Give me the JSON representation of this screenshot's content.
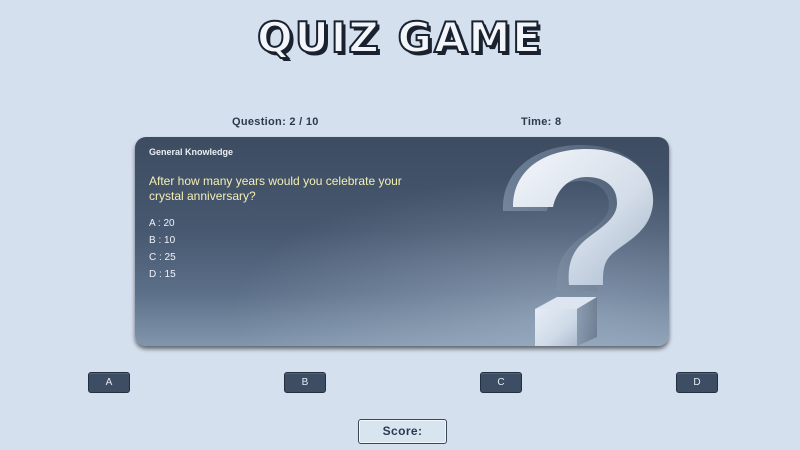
{
  "game": {
    "logo_text": "QUIZ GAME"
  },
  "hud": {
    "question_label": "Question: 2 / 10",
    "time_label": "Time: 8"
  },
  "card": {
    "category": "General Knowledge",
    "question": "After how many years would you celebrate your crystal anniversary?",
    "options": [
      "A : 20",
      "B : 10",
      "C : 25",
      "D : 15"
    ],
    "image_icon": "question-mark-icon"
  },
  "answers": [
    {
      "label": "A"
    },
    {
      "label": "B"
    },
    {
      "label": "C"
    },
    {
      "label": "D"
    }
  ],
  "score": {
    "label": "Score:"
  },
  "colors": {
    "background": "#d5e0ef",
    "card": "#475870",
    "question_text": "#f3efb3",
    "button": "#3d4d63",
    "hud_text": "#2c3a4c"
  }
}
